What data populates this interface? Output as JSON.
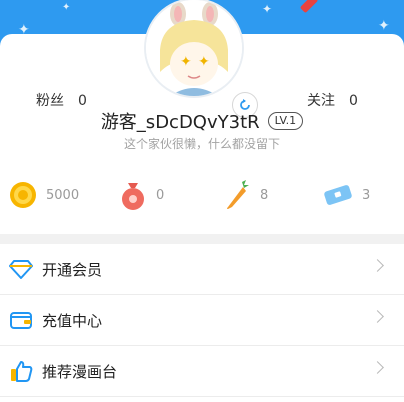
{
  "profile": {
    "fans_label": "粉丝",
    "fans_count": "0",
    "follow_label": "关注",
    "follow_count": "0",
    "username": "游客_sDcDQvY3tR",
    "level": "LV.1",
    "bio": "这个家伙很懒，什么都没留下"
  },
  "assets": [
    {
      "icon": "gold-coin-icon",
      "value": "5000"
    },
    {
      "icon": "red-pouch-icon",
      "value": "0"
    },
    {
      "icon": "carrot-icon",
      "value": "8"
    },
    {
      "icon": "ticket-icon",
      "value": "3"
    }
  ],
  "menu": [
    {
      "icon": "diamond-icon",
      "label": "开通会员"
    },
    {
      "icon": "wallet-icon",
      "label": "充值中心"
    },
    {
      "icon": "thumbs-up-icon",
      "label": "推荐漫画台"
    }
  ],
  "colors": {
    "header_blue": "#2e9af0",
    "accent_yellow": "#f7b500",
    "menu_icon_blue": "#2196f3",
    "muted_text": "#a3a3a3"
  }
}
